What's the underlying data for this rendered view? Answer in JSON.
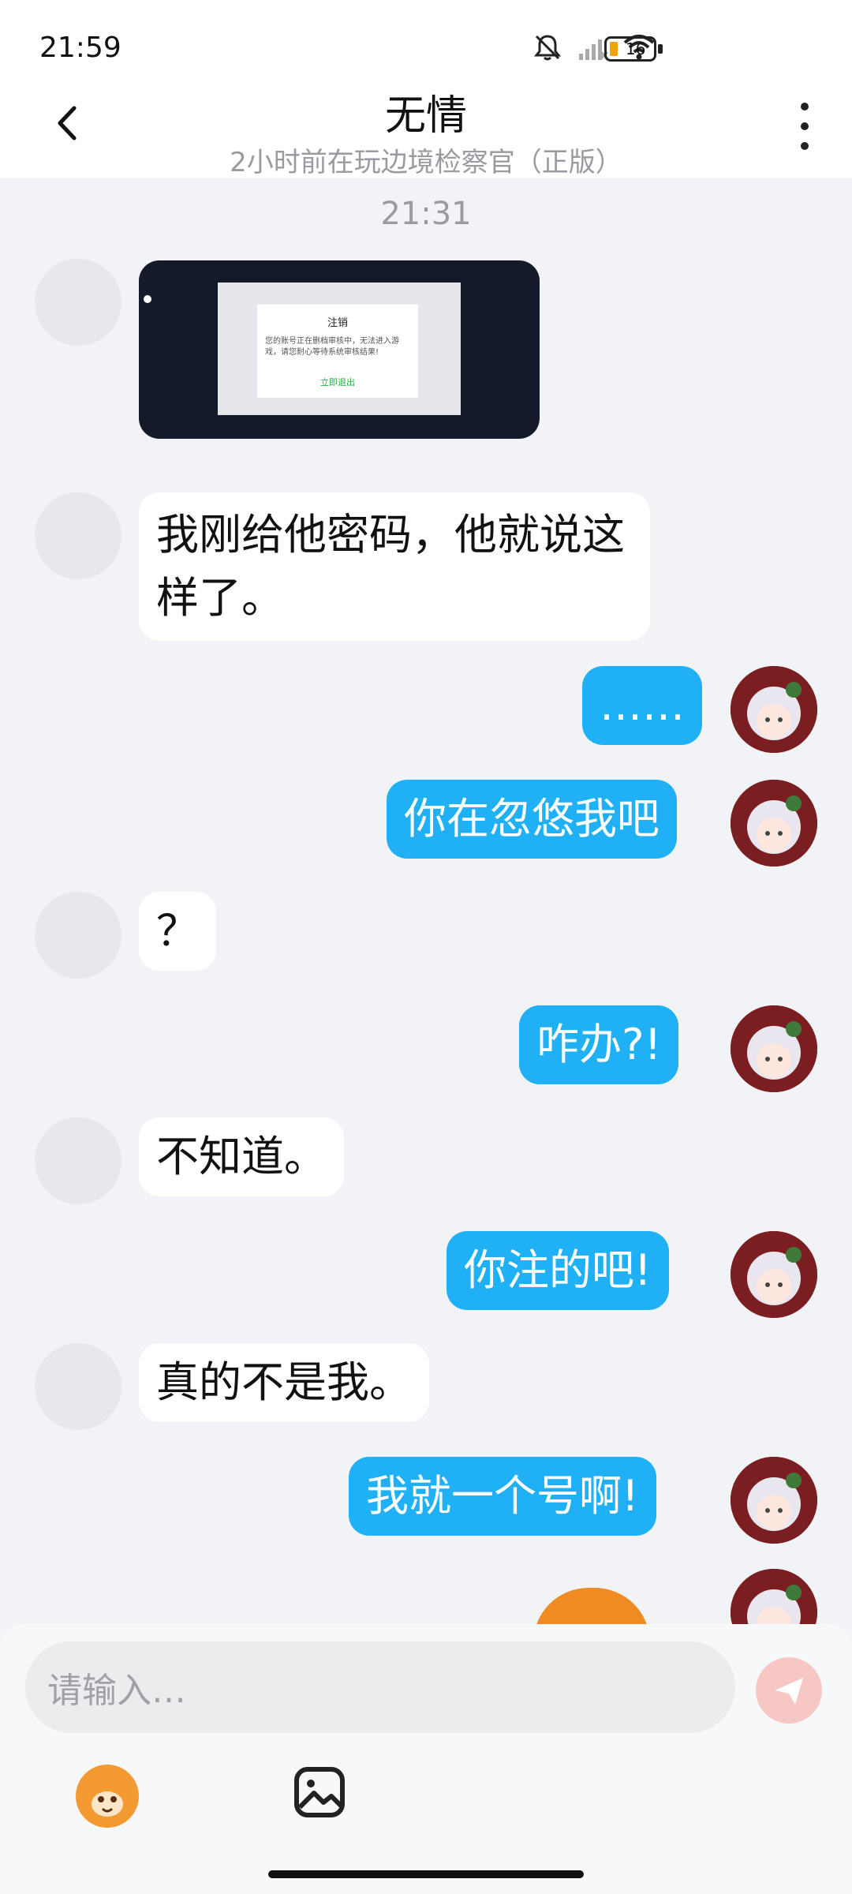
{
  "status_bar": {
    "time": "21:59",
    "battery": "16"
  },
  "header": {
    "title": "无情",
    "subtitle": "2小时前在玩边境检察官（正版）"
  },
  "chat": {
    "timestamp": "21:31",
    "image_message": {
      "dialog_title": "注销",
      "dialog_body": "您的账号正在删档审核中，无法进入游戏，请您耐心等待系统审核结果!",
      "dialog_action": "立即退出"
    },
    "messages": [
      {
        "side": "left",
        "text": "我刚给他密码，他就说这样了。"
      },
      {
        "side": "right",
        "text": "……"
      },
      {
        "side": "right",
        "text": "你在忽悠我吧"
      },
      {
        "side": "left",
        "text": "？"
      },
      {
        "side": "right",
        "text": "咋办?!"
      },
      {
        "side": "left",
        "text": "不知道。"
      },
      {
        "side": "right",
        "text": "你注的吧!"
      },
      {
        "side": "left",
        "text": "真的不是我。"
      },
      {
        "side": "right",
        "text": "我就一个号啊!"
      }
    ]
  },
  "input": {
    "placeholder": "请输入…"
  },
  "icons": [
    "back-arrow-icon",
    "more-icon",
    "mute-icon",
    "signal-icon",
    "wifi-icon",
    "send-icon",
    "emoji-icon",
    "image-icon"
  ],
  "colors": {
    "bubble_right": "#1fb0f5",
    "bubble_left": "#ffffff",
    "background": "#f2f3f6"
  }
}
